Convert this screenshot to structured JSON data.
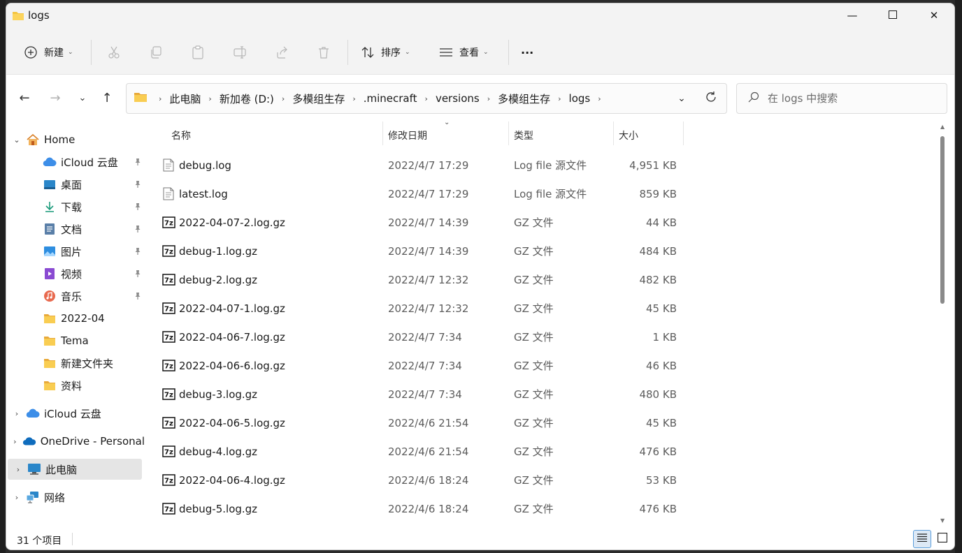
{
  "window": {
    "title": "logs",
    "minimize_glyph": "—",
    "maximize_glyph": "☐",
    "close_glyph": "✕"
  },
  "toolbar": {
    "new_label": "新建",
    "sort_label": "排序",
    "view_label": "查看",
    "more_label": "···"
  },
  "breadcrumb": [
    "此电脑",
    "新加卷 (D:)",
    "多模组生存",
    ".minecraft",
    "versions",
    "多模组生存",
    "logs"
  ],
  "search": {
    "placeholder": "在 logs 中搜索"
  },
  "sidebar": {
    "home": "Home",
    "quick": [
      {
        "label": "iCloud 云盘",
        "icon": "icloud-icon",
        "pinned": true
      },
      {
        "label": "桌面",
        "icon": "desktop-icon",
        "pinned": true
      },
      {
        "label": "下载",
        "icon": "download-icon",
        "pinned": true
      },
      {
        "label": "文档",
        "icon": "documents-icon",
        "pinned": true
      },
      {
        "label": "图片",
        "icon": "pictures-icon",
        "pinned": true
      },
      {
        "label": "视频",
        "icon": "videos-icon",
        "pinned": true
      },
      {
        "label": "音乐",
        "icon": "music-icon",
        "pinned": true
      },
      {
        "label": "2022-04",
        "icon": "folder-icon",
        "pinned": false
      },
      {
        "label": "Tema",
        "icon": "folder-icon",
        "pinned": false
      },
      {
        "label": "新建文件夹",
        "icon": "folder-icon",
        "pinned": false
      },
      {
        "label": "资料",
        "icon": "folder-icon",
        "pinned": false
      }
    ],
    "roots": [
      {
        "label": "iCloud 云盘",
        "icon": "icloud-icon"
      },
      {
        "label": "OneDrive - Personal",
        "icon": "onedrive-icon"
      },
      {
        "label": "此电脑",
        "icon": "this-pc-icon",
        "selected": true
      },
      {
        "label": "网络",
        "icon": "network-icon"
      }
    ]
  },
  "columns": {
    "name": "名称",
    "date": "修改日期",
    "type": "类型",
    "size": "大小"
  },
  "files": [
    {
      "name": "debug.log",
      "date": "2022/4/7 17:29",
      "type": "Log file 源文件",
      "size": "4,951 KB",
      "icon": "log-file-icon"
    },
    {
      "name": "latest.log",
      "date": "2022/4/7 17:29",
      "type": "Log file 源文件",
      "size": "859 KB",
      "icon": "log-file-icon"
    },
    {
      "name": "2022-04-07-2.log.gz",
      "date": "2022/4/7 14:39",
      "type": "GZ 文件",
      "size": "44 KB",
      "icon": "7z-archive-icon"
    },
    {
      "name": "debug-1.log.gz",
      "date": "2022/4/7 14:39",
      "type": "GZ 文件",
      "size": "484 KB",
      "icon": "7z-archive-icon"
    },
    {
      "name": "debug-2.log.gz",
      "date": "2022/4/7 12:32",
      "type": "GZ 文件",
      "size": "482 KB",
      "icon": "7z-archive-icon"
    },
    {
      "name": "2022-04-07-1.log.gz",
      "date": "2022/4/7 12:32",
      "type": "GZ 文件",
      "size": "45 KB",
      "icon": "7z-archive-icon"
    },
    {
      "name": "2022-04-06-7.log.gz",
      "date": "2022/4/7 7:34",
      "type": "GZ 文件",
      "size": "1 KB",
      "icon": "7z-archive-icon"
    },
    {
      "name": "2022-04-06-6.log.gz",
      "date": "2022/4/7 7:34",
      "type": "GZ 文件",
      "size": "46 KB",
      "icon": "7z-archive-icon"
    },
    {
      "name": "debug-3.log.gz",
      "date": "2022/4/7 7:34",
      "type": "GZ 文件",
      "size": "480 KB",
      "icon": "7z-archive-icon"
    },
    {
      "name": "2022-04-06-5.log.gz",
      "date": "2022/4/6 21:54",
      "type": "GZ 文件",
      "size": "45 KB",
      "icon": "7z-archive-icon"
    },
    {
      "name": "debug-4.log.gz",
      "date": "2022/4/6 21:54",
      "type": "GZ 文件",
      "size": "476 KB",
      "icon": "7z-archive-icon"
    },
    {
      "name": "2022-04-06-4.log.gz",
      "date": "2022/4/6 18:24",
      "type": "GZ 文件",
      "size": "53 KB",
      "icon": "7z-archive-icon"
    },
    {
      "name": "debug-5.log.gz",
      "date": "2022/4/6 18:24",
      "type": "GZ 文件",
      "size": "476 KB",
      "icon": "7z-archive-icon"
    }
  ],
  "status": {
    "item_count": "31 个项目"
  },
  "colors": {
    "folder": "#f4c542",
    "accent": "#0067c0",
    "selected_bg": "#e5e5e5"
  }
}
